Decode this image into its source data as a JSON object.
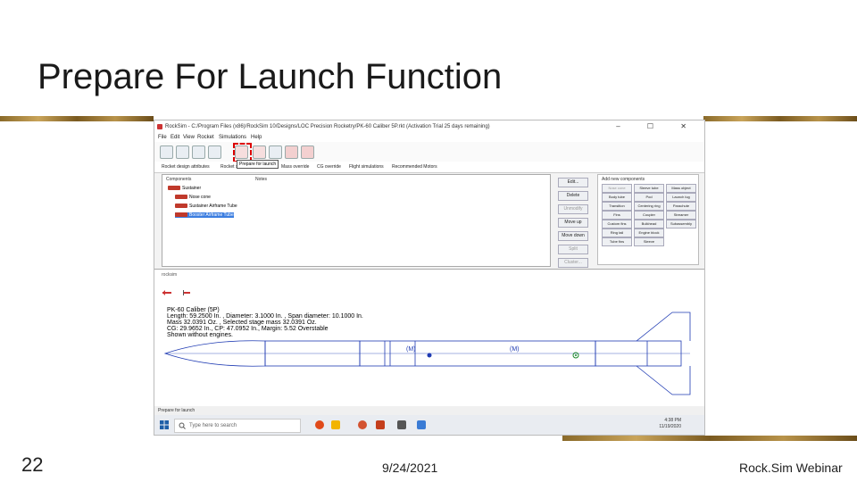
{
  "slide": {
    "title": "Prepare For Launch Function",
    "page_number": "22",
    "date": "9/24/2021",
    "brand": "Rock.Sim Webinar"
  },
  "window": {
    "title": "RockSim - C:/Program Files (x86)/RockSim 10/Designs/LOC Precision Rocketry/PK-60 Caliber 5P.rkt (Activation Trial 25 days remaining)",
    "controls": "–  ☐  ✕"
  },
  "menu": [
    "File",
    "Edit",
    "View",
    "Rocket",
    "Simulations",
    "Help"
  ],
  "tooltip": "Prepare for launch",
  "tabs": [
    "Rocket design attributes",
    "Rocket stages",
    "Mass override",
    "CG override",
    "Flight simulations",
    "Recommended Motors"
  ],
  "components_panel": {
    "header_components": "Components",
    "header_notes": "Notes",
    "tree": [
      {
        "label": "Sustainer"
      },
      {
        "label": "Nose cone"
      },
      {
        "label": "Sustainer Airframe Tube"
      },
      {
        "label": "Booster Airframe Tube"
      }
    ]
  },
  "side_buttons": [
    "Edit...",
    "Delete",
    "Unmodify",
    "Move up",
    "Move down",
    "Split",
    "Cluster..."
  ],
  "add_panel": {
    "title": "Add new components",
    "buttons": [
      "Nose cone",
      "Sleeve tube",
      "Mass object",
      "Body tube",
      "Pod",
      "Launch lug",
      "Transition",
      "Centering ring",
      "Parachute",
      "Fins",
      "Coupler",
      "Streamer",
      "Custom fins",
      "Bulkhead",
      "Subassembly",
      "Ring tail",
      "Engine block",
      "",
      "Tube fins",
      "Sleeve",
      ""
    ]
  },
  "rocket_window": {
    "title": "rocksim",
    "info_lines": [
      "PK-60 Caliber (5P)",
      "Length: 59.2500 In. , Diameter: 3.1000 In. , Span diameter: 10.1000 In.",
      "Mass 32.0391 Oz. , Selected stage mass 32.0391 Oz.",
      "CG: 29.9652 In., CP: 47.0952 In., Margin: 5.52 Overstable",
      "Shown without engines."
    ],
    "motor_labels": [
      "(M)",
      "(M)"
    ]
  },
  "status_bar": "Prepare for launch",
  "taskbar": {
    "search_placeholder": "Type here to search",
    "time": "4:38 PM",
    "date": "11/19/2020"
  },
  "colors": {
    "accent_band": "#b8934a",
    "rocket_outline": "#1f3bb3",
    "selection": "#3b7de0",
    "highlight_box": "#dd0000"
  }
}
